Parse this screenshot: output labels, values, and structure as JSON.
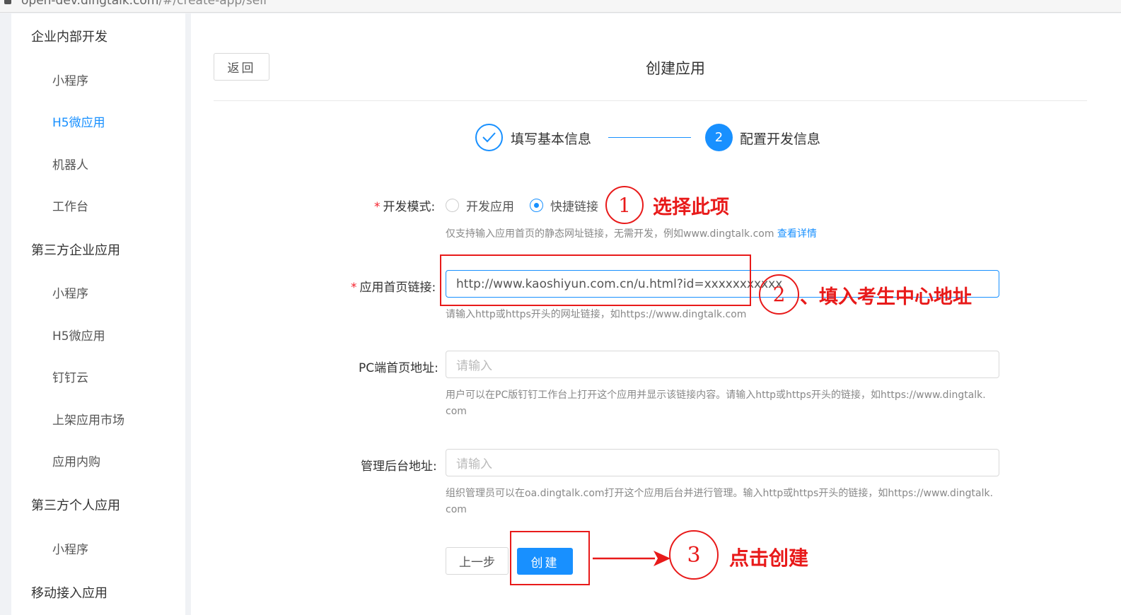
{
  "browser": {
    "url_host": "open-dev.dingtalk.com",
    "url_rest": "/#/create-app/self"
  },
  "sidebar": {
    "groups": [
      {
        "label": "企业内部开发",
        "items": [
          {
            "label": "小程序"
          },
          {
            "label": "H5微应用",
            "active": true
          },
          {
            "label": "机器人"
          },
          {
            "label": "工作台"
          }
        ]
      },
      {
        "label": "第三方企业应用",
        "items": [
          {
            "label": "小程序"
          },
          {
            "label": "H5微应用"
          },
          {
            "label": "钉钉云"
          },
          {
            "label": "上架应用市场"
          },
          {
            "label": "应用内购"
          }
        ]
      },
      {
        "label": "第三方个人应用",
        "items": [
          {
            "label": "小程序"
          }
        ]
      },
      {
        "label": "移动接入应用",
        "items": []
      }
    ]
  },
  "header": {
    "back_label": "返回",
    "title": "创建应用"
  },
  "steps": [
    {
      "label": "填写基本信息",
      "status": "done"
    },
    {
      "label": "配置开发信息",
      "number": "2",
      "status": "active"
    }
  ],
  "form": {
    "dev_mode": {
      "label": "开发模式:",
      "options": [
        {
          "label": "开发应用",
          "checked": false
        },
        {
          "label": "快捷链接",
          "checked": true
        }
      ],
      "help": "仅支持输入应用首页的静态网址链接，无需开发，例如www.dingtalk.com",
      "help_link": "查看详情"
    },
    "home_url": {
      "label": "应用首页链接:",
      "value": "http://www.kaoshiyun.com.cn/u.html?id=xxxxxxxxxxx",
      "help": "请输入http或https开头的网址链接，如https://www.dingtalk.com"
    },
    "pc_url": {
      "label": "PC端首页地址:",
      "placeholder": "请输入",
      "help_line1": "用户可以在PC版钉钉工作台上打开这个应用并显示该链接内容。请输入http或https开头的链接，如https://www.dingtalk.",
      "help_line2": "com"
    },
    "admin_url": {
      "label": "管理后台地址:",
      "placeholder": "请输入",
      "help_line1": "组织管理员可以在oa.dingtalk.com打开这个应用后台并进行管理。输入http或https开头的链接，如https://www.dingtalk.",
      "help_line2": "com"
    },
    "prev_label": "上一步",
    "create_label": "创建"
  },
  "annotations": {
    "color": "#e81a1a",
    "step1": {
      "number": "1",
      "text": "选择此项"
    },
    "step2": {
      "number": "2",
      "text": "、填入考生中心地址"
    },
    "step3": {
      "number": "3",
      "text": "点击创建"
    }
  },
  "colors": {
    "primary": "#1890ff",
    "required": "#f5222d",
    "annotation": "#e81a1a"
  }
}
